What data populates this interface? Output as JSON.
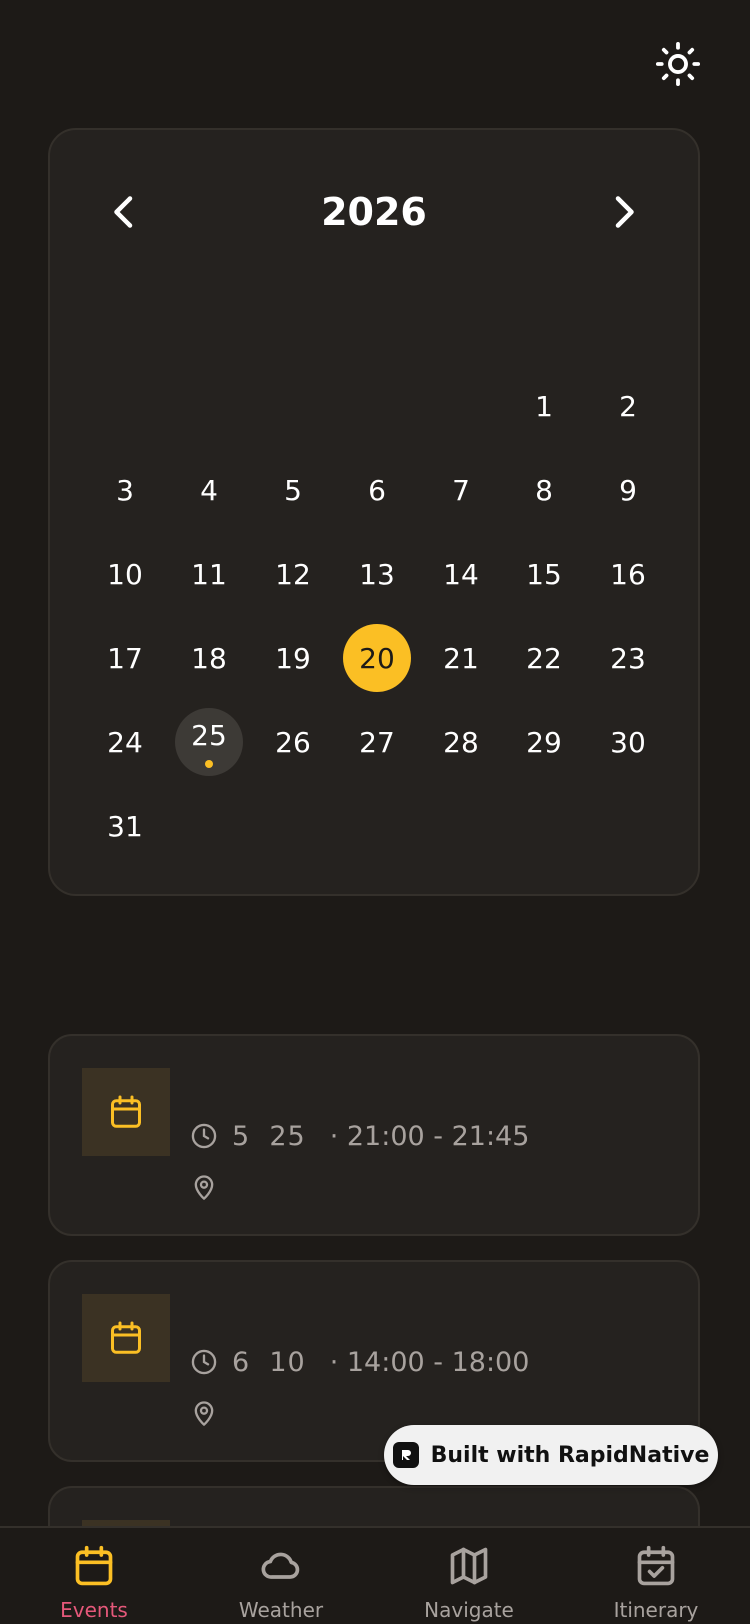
{
  "calendar": {
    "year": "2026",
    "leading_blanks": 5,
    "days": [
      "1",
      "2",
      "3",
      "4",
      "5",
      "6",
      "7",
      "8",
      "9",
      "10",
      "11",
      "12",
      "13",
      "14",
      "15",
      "16",
      "17",
      "18",
      "19",
      "20",
      "21",
      "22",
      "23",
      "24",
      "25",
      "26",
      "27",
      "28",
      "29",
      "30",
      "31"
    ],
    "selected_day": "20",
    "event_days": [
      "25"
    ]
  },
  "events": [
    {
      "date": "5  25",
      "time": "· 21:00 - 21:45"
    },
    {
      "date": "6  10",
      "time": "· 14:00 - 18:00"
    }
  ],
  "badge": {
    "label": "Built with RapidNative"
  },
  "tabs": [
    {
      "label": "Events",
      "icon": "calendar-icon",
      "active": true
    },
    {
      "label": "Weather",
      "icon": "cloud-icon",
      "active": false
    },
    {
      "label": "Navigate",
      "icon": "map-icon",
      "active": false
    },
    {
      "label": "Itinerary",
      "icon": "calendar-check-icon",
      "active": false
    }
  ],
  "colors": {
    "accent": "#fbbf24",
    "background": "#1d1a17",
    "card": "#25221f",
    "active_tab_label": "#e5587a",
    "muted": "#a8a29e"
  }
}
